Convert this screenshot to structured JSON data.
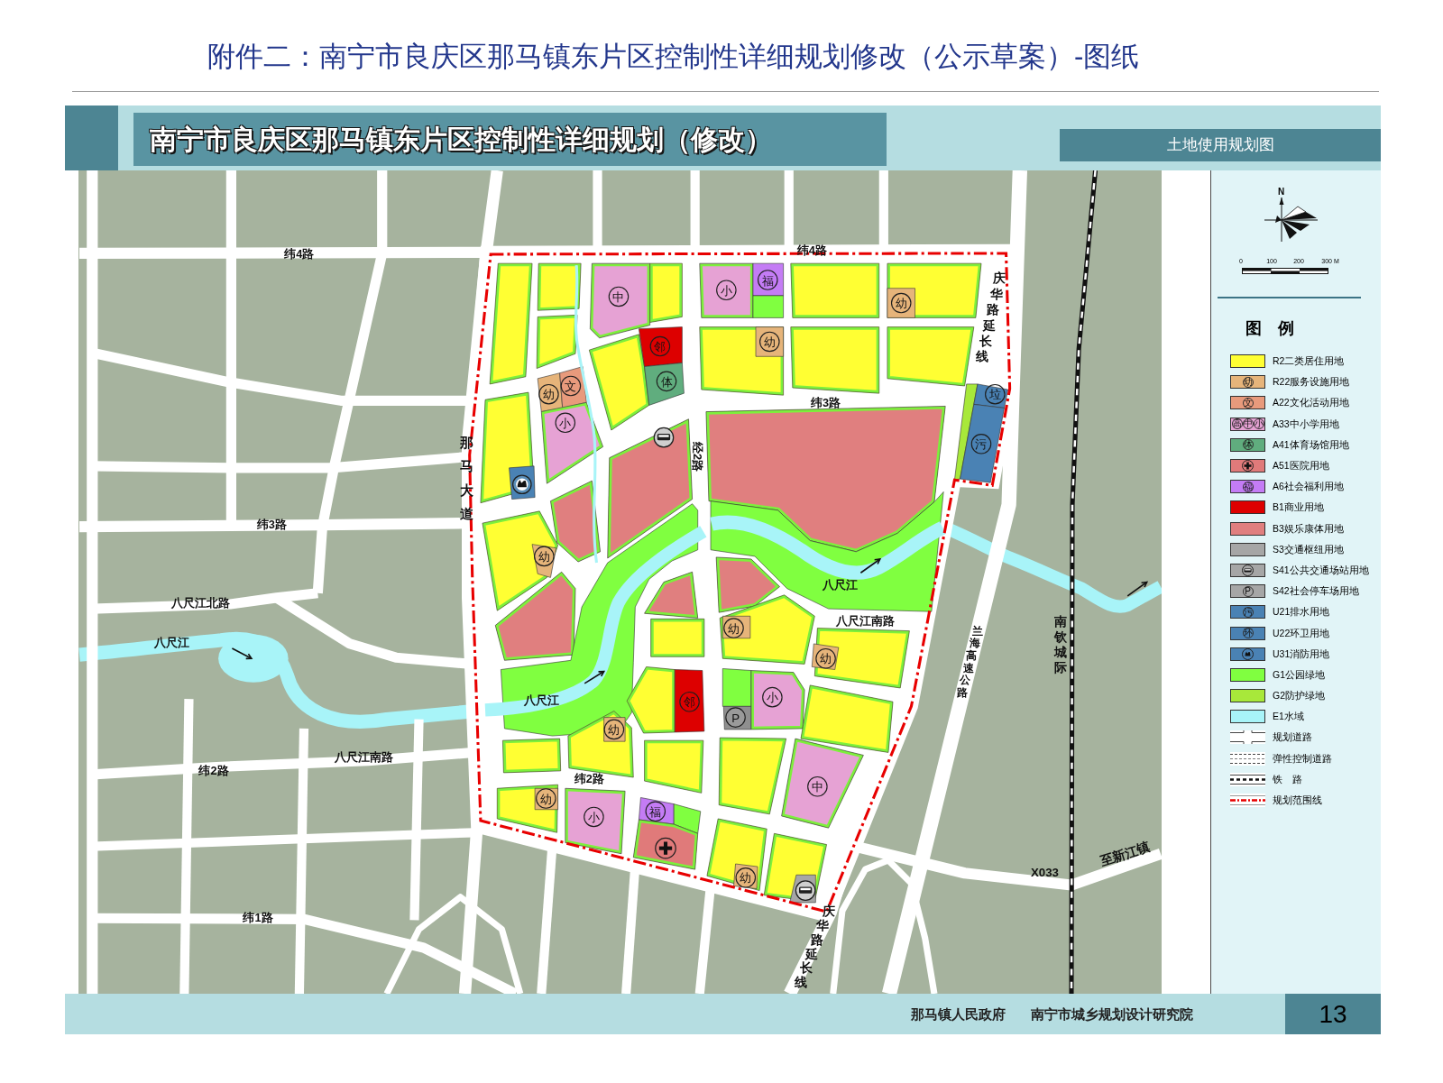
{
  "page_title": "附件二：南宁市良庆区那马镇东片区控制性详细规划修改（公示草案）-图纸",
  "banner": {
    "title": "南宁市良庆区那马镇东片区控制性详细规划（修改）",
    "map_name": "土地使用规划图"
  },
  "map": {
    "road_names": [
      "纬4路",
      "纬4路",
      "纬3路",
      "纬3路",
      "八尺江北路",
      "那马大道",
      "经2路",
      "庆华路延长线",
      "八尺江南路",
      "兰海高速公路",
      "八尺江南路",
      "纬2路",
      "纬2路",
      "X033",
      "纬1路",
      "庆华路延长线"
    ],
    "river_names": [
      "八尺江",
      "八尺江",
      "八尺江"
    ],
    "railway_name": "南钦城际",
    "destination": "至新江镇",
    "parcels": [
      {
        "kind": "R2"
      },
      {
        "kind": "R2"
      },
      {
        "kind": "A33",
        "symbol": "中"
      },
      {
        "kind": "R2"
      },
      {
        "kind": "A33",
        "symbol": "小"
      },
      {
        "kind": "A6",
        "symbol": "福"
      },
      {
        "kind": "G1"
      },
      {
        "kind": "R2"
      },
      {
        "kind": "R2"
      },
      {
        "kind": "R22",
        "symbol": "幼"
      },
      {
        "kind": "R2"
      },
      {
        "kind": "R2"
      },
      {
        "kind": "B1",
        "symbol": "邻"
      },
      {
        "kind": "A41",
        "symbol": "体"
      },
      {
        "kind": "R2"
      },
      {
        "kind": "R22",
        "symbol": "幼"
      },
      {
        "kind": "R2"
      },
      {
        "kind": "R2"
      },
      {
        "kind": "R22",
        "symbol": "幼"
      },
      {
        "kind": "A22",
        "symbol": "文"
      },
      {
        "kind": "A33",
        "symbol": "小"
      },
      {
        "kind": "R2"
      },
      {
        "kind": "U31"
      },
      {
        "kind": "R2"
      },
      {
        "kind": "R22",
        "symbol": "幼"
      },
      {
        "kind": "B3"
      },
      {
        "kind": "B3"
      },
      {
        "kind": "B3"
      },
      {
        "kind": "B3"
      },
      {
        "kind": "G1"
      },
      {
        "kind": "G1"
      },
      {
        "kind": "B3"
      },
      {
        "kind": "B3"
      },
      {
        "kind": "R2"
      },
      {
        "kind": "R2"
      },
      {
        "kind": "R22",
        "symbol": "幼"
      },
      {
        "kind": "R2"
      },
      {
        "kind": "R22",
        "symbol": "幼"
      },
      {
        "kind": "R2"
      },
      {
        "kind": "B1",
        "symbol": "邻"
      },
      {
        "kind": "G1"
      },
      {
        "kind": "S42",
        "symbol": "P"
      },
      {
        "kind": "A33",
        "symbol": "小"
      },
      {
        "kind": "R2"
      },
      {
        "kind": "R2"
      },
      {
        "kind": "R2"
      },
      {
        "kind": "R22",
        "symbol": "幼"
      },
      {
        "kind": "R2"
      },
      {
        "kind": "R2"
      },
      {
        "kind": "A33",
        "symbol": "中"
      },
      {
        "kind": "R2"
      },
      {
        "kind": "R22",
        "symbol": "幼"
      },
      {
        "kind": "A33",
        "symbol": "小"
      },
      {
        "kind": "A6",
        "symbol": "福"
      },
      {
        "kind": "G1"
      },
      {
        "kind": "A51"
      },
      {
        "kind": "R2"
      },
      {
        "kind": "R22",
        "symbol": "幼"
      },
      {
        "kind": "R2"
      },
      {
        "kind": "S41"
      },
      {
        "kind": "G2"
      },
      {
        "kind": "U22",
        "symbol": "垃"
      },
      {
        "kind": "U21",
        "symbol": "污"
      }
    ]
  },
  "legend": {
    "north_label": "N",
    "scale_labels": [
      "0",
      "100",
      "200",
      "300 M"
    ],
    "title": "图　例",
    "items": [
      {
        "label": "R2二类居住用地",
        "kind": "fill",
        "color": "#ffff33"
      },
      {
        "label": "R22服务设施用地",
        "kind": "symbol",
        "color": "#e6b47a",
        "symbols": [
          "幼"
        ]
      },
      {
        "label": "A22文化活动用地",
        "kind": "symbol",
        "color": "#e89a7c",
        "symbols": [
          "文"
        ]
      },
      {
        "label": "A33中小学用地",
        "kind": "symbol",
        "color": "#e6a2d4",
        "symbols": [
          "高",
          "中",
          "小"
        ]
      },
      {
        "label": "A41体育场馆用地",
        "kind": "symbol",
        "color": "#60ad7e",
        "symbols": [
          "体"
        ]
      },
      {
        "label": "A51医院用地",
        "kind": "cross",
        "color": "#e07a7a"
      },
      {
        "label": "A6社会福利用地",
        "kind": "symbol",
        "color": "#c47cf5",
        "symbols": [
          "福"
        ]
      },
      {
        "label": "B1商业用地",
        "kind": "fill",
        "color": "#dd0000"
      },
      {
        "label": "B3娱乐康体用地",
        "kind": "fill",
        "color": "#e07f7f"
      },
      {
        "label": "S3交通枢纽用地",
        "kind": "fill",
        "color": "#a6a6a6"
      },
      {
        "label": "S41公共交通场站用地",
        "kind": "bus",
        "color": "#a6a6a6"
      },
      {
        "label": "S42社会停车场用地",
        "kind": "symbol",
        "color": "#a6a6a6",
        "symbols": [
          "P"
        ]
      },
      {
        "label": "U21排水用地",
        "kind": "symbol",
        "color": "#4a82b4",
        "symbols": [
          "污"
        ]
      },
      {
        "label": "U22环卫用地",
        "kind": "symbol",
        "color": "#4a82b4",
        "symbols": [
          "环"
        ]
      },
      {
        "label": "U31消防用地",
        "kind": "fire",
        "color": "#4a82b4"
      },
      {
        "label": "G1公园绿地",
        "kind": "fill",
        "color": "#80ff40"
      },
      {
        "label": "G2防护绿地",
        "kind": "fill",
        "color": "#a8e83a"
      },
      {
        "label": "E1水域",
        "kind": "fill",
        "color": "#a8f4f8"
      },
      {
        "label": "规划道路",
        "kind": "road"
      },
      {
        "label": "弹性控制道路",
        "kind": "flex-road"
      },
      {
        "label": "铁　路",
        "kind": "railway"
      },
      {
        "label": "规划范围线",
        "kind": "boundary"
      }
    ]
  },
  "footer": {
    "credits": [
      "那马镇人民政府",
      "南宁市城乡规划设计研究院"
    ],
    "page_number": "13"
  }
}
